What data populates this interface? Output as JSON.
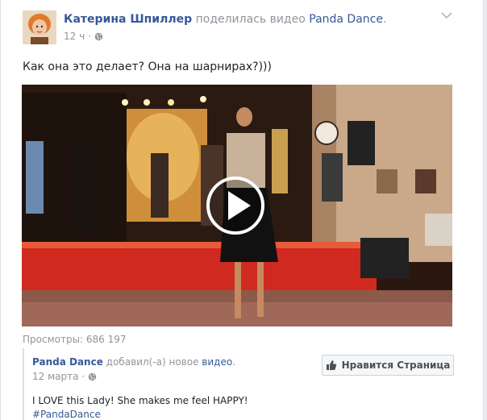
{
  "post": {
    "author": "Катерина Шпиллер",
    "action": "поделилась видео",
    "shared_from": "Panda Dance",
    "time": "12 ч",
    "privacy_icon": "globe-icon",
    "text": "Как она это делает? Она на шарнирах?)))"
  },
  "video": {
    "views": "Просмотры: 686 197",
    "play_icon": "play-icon"
  },
  "shared": {
    "page_name": "Panda Dance",
    "added_text": "добавил(-а) новое",
    "video_link": "видео",
    "date": "12 марта",
    "like_button": "Нравится Страница",
    "description": "I LOVE this Lady! She makes me feel HAPPY!",
    "hashtag": "#PandaDance"
  },
  "colors": {
    "link": "#365899",
    "meta": "#90949c",
    "text": "#1d2129"
  }
}
